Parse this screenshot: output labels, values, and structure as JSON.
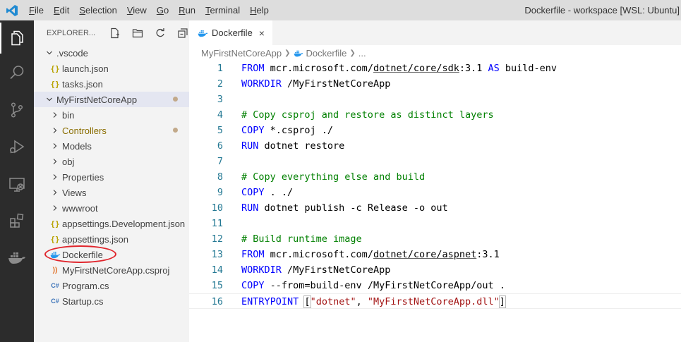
{
  "titlebar": {
    "menu": [
      {
        "label": "File",
        "mnemonic": "F",
        "rest": "ile"
      },
      {
        "label": "Edit",
        "mnemonic": "E",
        "rest": "dit"
      },
      {
        "label": "Selection",
        "mnemonic": "S",
        "rest": "election"
      },
      {
        "label": "View",
        "mnemonic": "V",
        "rest": "iew"
      },
      {
        "label": "Go",
        "mnemonic": "G",
        "rest": "o"
      },
      {
        "label": "Run",
        "mnemonic": "R",
        "rest": "un"
      },
      {
        "label": "Terminal",
        "mnemonic": "T",
        "rest": "erminal"
      },
      {
        "label": "Help",
        "mnemonic": "H",
        "rest": "elp"
      }
    ],
    "window_title": "Dockerfile - workspace [WSL: Ubuntu]"
  },
  "activitybar": {
    "items": [
      "explorer-icon",
      "search-icon",
      "source-control-icon",
      "run-debug-icon",
      "remote-explorer-icon",
      "extensions-icon",
      "docker-icon"
    ],
    "active": "explorer-icon"
  },
  "sidebar": {
    "title": "EXPLORER...",
    "actions": [
      "new-file-icon",
      "new-folder-icon",
      "refresh-icon",
      "collapse-all-icon"
    ],
    "tree": [
      {
        "label": ".vscode",
        "kind": "folder",
        "expanded": true,
        "depth": 0
      },
      {
        "label": "launch.json",
        "kind": "json",
        "depth": 1
      },
      {
        "label": "tasks.json",
        "kind": "json",
        "depth": 1
      },
      {
        "label": "MyFirstNetCoreApp",
        "kind": "folder",
        "expanded": true,
        "depth": 0,
        "selected": true,
        "modified": true
      },
      {
        "label": "bin",
        "kind": "folder",
        "expanded": false,
        "depth": 1
      },
      {
        "label": "Controllers",
        "kind": "folder",
        "expanded": false,
        "depth": 1,
        "modified": true
      },
      {
        "label": "Models",
        "kind": "folder",
        "expanded": false,
        "depth": 1
      },
      {
        "label": "obj",
        "kind": "folder",
        "expanded": false,
        "depth": 1
      },
      {
        "label": "Properties",
        "kind": "folder",
        "expanded": false,
        "depth": 1
      },
      {
        "label": "Views",
        "kind": "folder",
        "expanded": false,
        "depth": 1
      },
      {
        "label": "wwwroot",
        "kind": "folder",
        "expanded": false,
        "depth": 1
      },
      {
        "label": "appsettings.Development.json",
        "kind": "json",
        "depth": 1
      },
      {
        "label": "appsettings.json",
        "kind": "json",
        "depth": 1
      },
      {
        "label": "Dockerfile",
        "kind": "docker",
        "depth": 1,
        "highlighted": true
      },
      {
        "label": "MyFirstNetCoreApp.csproj",
        "kind": "rss",
        "depth": 1
      },
      {
        "label": "Program.cs",
        "kind": "cs",
        "depth": 1
      },
      {
        "label": "Startup.cs",
        "kind": "cs",
        "depth": 1
      }
    ]
  },
  "tabs": [
    {
      "label": "Dockerfile",
      "active": true,
      "close": "×"
    }
  ],
  "breadcrumb": [
    "MyFirstNetCoreApp",
    "Dockerfile",
    "..."
  ],
  "editor": {
    "current_line": 16,
    "lines": [
      [
        {
          "t": "FROM",
          "c": "kw"
        },
        {
          "t": " mcr.microsoft.com/"
        },
        {
          "t": "dotnet/core/sdk",
          "c": "ul"
        },
        {
          "t": ":3.1 "
        },
        {
          "t": "AS",
          "c": "kw"
        },
        {
          "t": " build-env"
        }
      ],
      [
        {
          "t": "WORKDIR",
          "c": "kw"
        },
        {
          "t": " /MyFirstNetCoreApp"
        }
      ],
      [],
      [
        {
          "t": "# Copy csproj and restore as distinct layers",
          "c": "cm"
        }
      ],
      [
        {
          "t": "COPY",
          "c": "kw"
        },
        {
          "t": " *.csproj ./"
        }
      ],
      [
        {
          "t": "RUN",
          "c": "kw"
        },
        {
          "t": " dotnet restore"
        }
      ],
      [],
      [
        {
          "t": "# Copy everything else and build",
          "c": "cm"
        }
      ],
      [
        {
          "t": "COPY",
          "c": "kw"
        },
        {
          "t": " . ./"
        }
      ],
      [
        {
          "t": "RUN",
          "c": "kw"
        },
        {
          "t": " dotnet publish -c Release -o out"
        }
      ],
      [],
      [
        {
          "t": "# Build runtime image",
          "c": "cm"
        }
      ],
      [
        {
          "t": "FROM",
          "c": "kw"
        },
        {
          "t": " mcr.microsoft.com/"
        },
        {
          "t": "dotnet/core/aspnet",
          "c": "ul"
        },
        {
          "t": ":3.1"
        }
      ],
      [
        {
          "t": "WORKDIR",
          "c": "kw"
        },
        {
          "t": " /MyFirstNetCoreApp"
        }
      ],
      [
        {
          "t": "COPY",
          "c": "kw"
        },
        {
          "t": " --from=build-env /MyFirstNetCoreApp/out ."
        }
      ],
      [
        {
          "t": "ENTRYPOINT",
          "c": "kw"
        },
        {
          "t": " "
        },
        {
          "t": "[",
          "c": "bracket"
        },
        {
          "t": "\"dotnet\"",
          "c": "str"
        },
        {
          "t": ", "
        },
        {
          "t": "\"MyFirstNetCoreApp.dll\"",
          "c": "str"
        },
        {
          "t": "]",
          "c": "bracket"
        }
      ]
    ]
  },
  "colors": {
    "keyword": "#0000ff",
    "comment": "#008000",
    "string": "#a31515",
    "line_number": "#237893",
    "activity_bar": "#2c2c2c",
    "sidebar": "#f3f3f3",
    "titlebar": "#dddddd",
    "vscode_logo": "#1f8ad2",
    "docker_blue": "#2396ed",
    "highlight_ring": "#e0242b"
  }
}
